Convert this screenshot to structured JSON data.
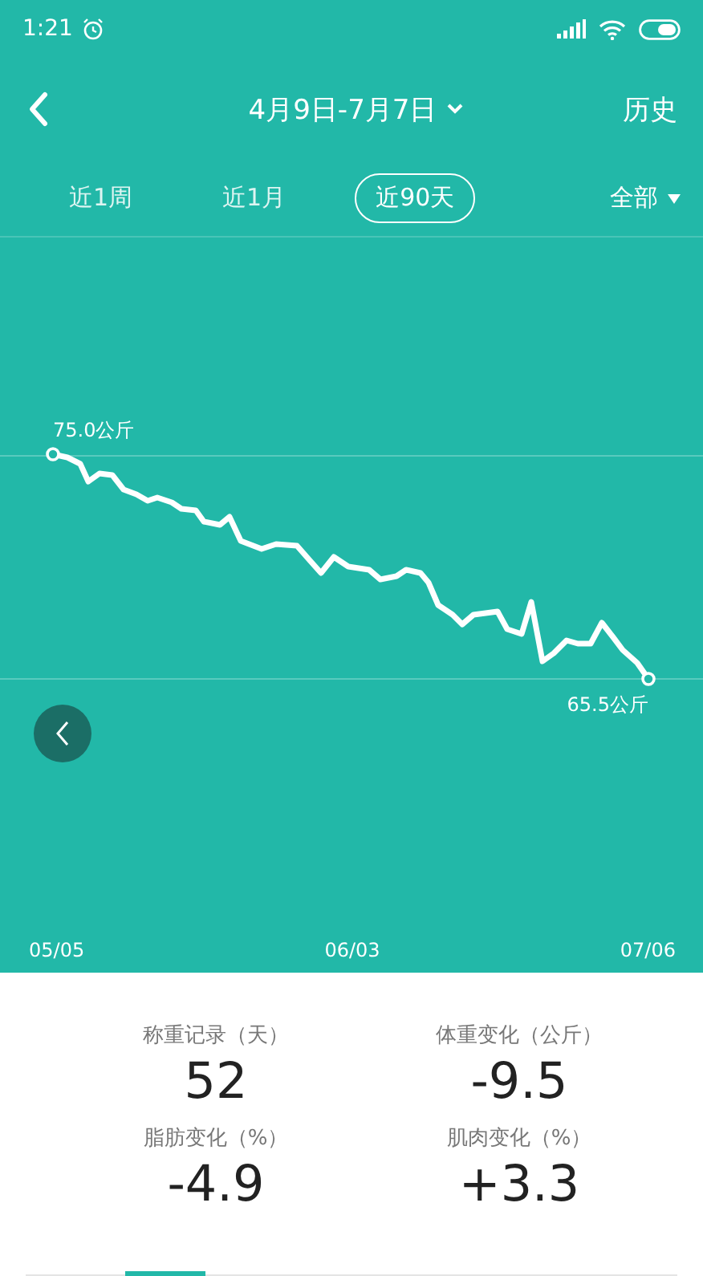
{
  "status_bar": {
    "time": "1:21"
  },
  "header": {
    "date_range": "4月9日-7月7日",
    "history": "历史"
  },
  "tabs": [
    {
      "label": "近1周",
      "selected": false
    },
    {
      "label": "近1月",
      "selected": false
    },
    {
      "label": "近90天",
      "selected": true
    }
  ],
  "filter": {
    "label": "全部"
  },
  "chart": {
    "start_label": "75.0公斤",
    "end_label": "65.5公斤",
    "x_labels": [
      "05/05",
      "06/03",
      "07/06"
    ]
  },
  "stats": [
    {
      "label": "称重记录（天）",
      "value": "52"
    },
    {
      "label": "体重变化（公斤）",
      "value": "-9.5"
    },
    {
      "label": "脂肪变化（%）",
      "value": "-4.9"
    },
    {
      "label": "肌肉变化（%）",
      "value": "+3.3"
    }
  ]
}
